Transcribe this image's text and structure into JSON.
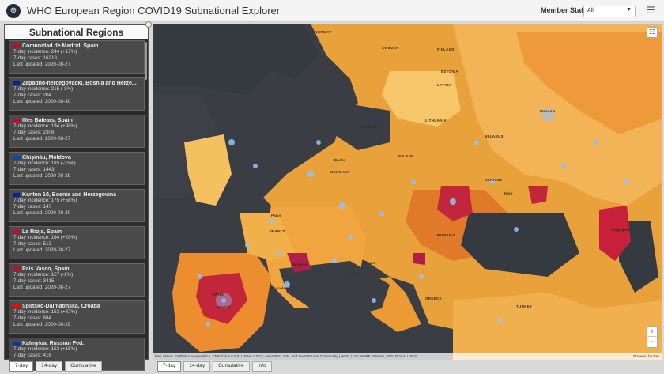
{
  "header": {
    "title": "WHO European Region COVID19 Subnational Explorer",
    "member_state_label": "Member State:",
    "member_state_value": "All"
  },
  "panel": {
    "title": "Subnational Regions",
    "cards": [
      {
        "name": "Comunidad de Madrid, Spain",
        "incidence": "7-day incidence: 244 (+17%)",
        "cases": "7-day cases: 16218",
        "updated": "Last updated: 2020-08-27",
        "flag": "#c60b1e"
      },
      {
        "name": "Zapadno-hercegovački, Bosnia and Herze...",
        "incidence": "7-day incidence: 215 (-3%)",
        "cases": "7-day cases: 204",
        "updated": "Last updated: 2020-08-30",
        "flag": "#002395"
      },
      {
        "name": "Illes Balears, Spain",
        "incidence": "7-day incidence: 194 (+98%)",
        "cases": "7-day cases: 2306",
        "updated": "Last updated: 2020-08-27",
        "flag": "#c60b1e"
      },
      {
        "name": "Chişinău, Moldova",
        "incidence": "7-day incidence: 185 (-25%)",
        "cases": "7-day cases: 1443",
        "updated": "Last updated: 2020-08-29",
        "flag": "#0046ae"
      },
      {
        "name": "Kanton 10, Bosnia and Herzegovina",
        "incidence": "7-day incidence: 175 (+58%)",
        "cases": "7-day cases: 147",
        "updated": "Last updated: 2020-08-30",
        "flag": "#002395"
      },
      {
        "name": "La Rioja, Spain",
        "incidence": "7-day incidence: 164 (+20%)",
        "cases": "7-day cases: 513",
        "updated": "Last updated: 2020-08-27",
        "flag": "#c60b1e"
      },
      {
        "name": "País Vasco, Spain",
        "incidence": "7-day incidence: 157 (-1%)",
        "cases": "7-day cases: 3415",
        "updated": "Last updated: 2020-08-27",
        "flag": "#c60b1e"
      },
      {
        "name": "Splitsko-Dalmatinska, Croatia",
        "incidence": "7-day incidence: 153 (+37%)",
        "cases": "7-day cases: 684",
        "updated": "Last updated: 2020-08-29",
        "flag": "#ff0000"
      },
      {
        "name": "Kalmykia, Russian Fed.",
        "incidence": "7-day incidence: 153 (+15%)",
        "cases": "7-day cases: 416",
        "updated": "",
        "flag": "#0039a6"
      }
    ]
  },
  "left_tabs": [
    "7-day",
    "14-day",
    "Cumulative"
  ],
  "map_tabs": [
    "7-day",
    "14-day",
    "Cumulative",
    "Info"
  ],
  "map": {
    "attribution": "Esri, Maxar, Earthstar Geographics, CNES/Airbus DS, USDA, USGS, AeroGRID, IGN, and the GIS User Community | WHO | Esri, HERE, Garmin, FAO, NOAA, USGS",
    "powered_by": "Powered by Esri",
    "labels": [
      "NORWAY",
      "SWEDEN",
      "FINLAND",
      "ESTONIA",
      "LATVIA",
      "LITHUANIA",
      "DENMARK",
      "POLAND",
      "GERMANY",
      "UKRAINE",
      "FRANCE",
      "ROMANIA",
      "ITALY",
      "SPAIN",
      "GREECE",
      "TURKEY",
      "BELARUS",
      "Moscow",
      "Paris",
      "Madrid",
      "Rome",
      "Berlin",
      "Barcelona",
      "Marseille",
      "Kiev",
      "Volgograd"
    ]
  }
}
